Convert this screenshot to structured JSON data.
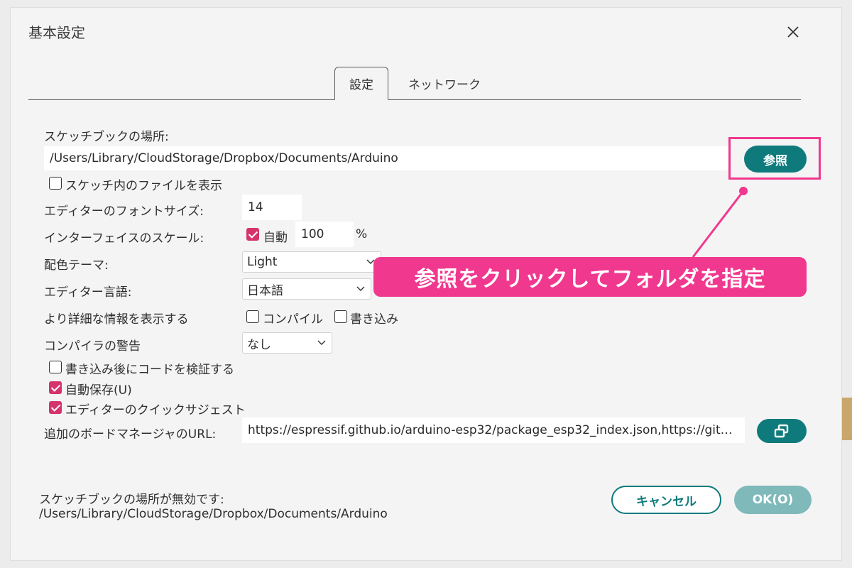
{
  "dialog": {
    "title": "基本設定"
  },
  "tabs": [
    {
      "label": "設定"
    },
    {
      "label": "ネットワーク"
    }
  ],
  "sketchbook": {
    "label": "スケッチブックの場所:",
    "path": "/Users/Library/CloudStorage/Dropbox/Documents/Arduino",
    "browse_label": "参照"
  },
  "show_files": {
    "label": "スケッチ内のファイルを表示",
    "checked": false
  },
  "font_size": {
    "label": "エディターのフォントサイズ:",
    "value": "14"
  },
  "scale": {
    "label": "インターフェイスのスケール:",
    "auto_label": "自動",
    "auto_checked": true,
    "value": "100",
    "unit": "%"
  },
  "theme": {
    "label": "配色テーマ:",
    "value": "Light"
  },
  "language": {
    "label": "エディター言語:",
    "value": "日本語"
  },
  "verbose": {
    "label": "より詳細な情報を表示する",
    "compile_label": "コンパイル",
    "upload_label": "書き込み"
  },
  "warnings": {
    "label": "コンパイラの警告",
    "value": "なし"
  },
  "verify_after_upload": {
    "label": "書き込み後にコードを検証する",
    "checked": false
  },
  "autosave": {
    "label": "自動保存(U)",
    "checked": true
  },
  "quick_suggest": {
    "label": "エディターのクイックサジェスト",
    "checked": true
  },
  "board_manager": {
    "label": "追加のボードマネージャのURL:",
    "value": "https://espressif.github.io/arduino-esp32/package_esp32_index.json,https://git…"
  },
  "status": {
    "line1": "スケッチブックの場所が無効です:",
    "line2": "/Users/Library/CloudStorage/Dropbox/Documents/Arduino"
  },
  "buttons": {
    "cancel": "キャンセル",
    "ok": "OK(O)"
  },
  "annotation": {
    "text": "参照をクリックしてフォルダを指定"
  },
  "colors": {
    "accent": "#0e7a7c",
    "highlight": "#f0388f",
    "checkbox": "#d6336c"
  }
}
